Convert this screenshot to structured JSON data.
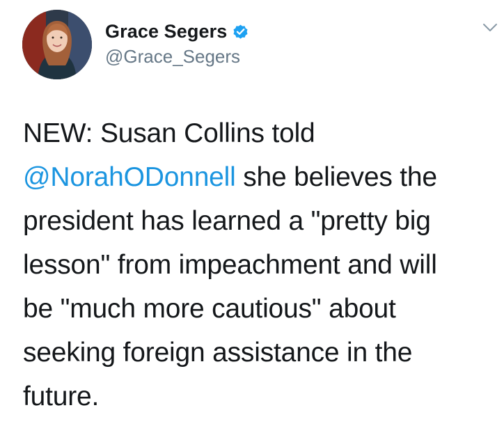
{
  "tweet": {
    "author": {
      "display_name": "Grace Segers",
      "handle": "@Grace_Segers",
      "verified": true,
      "verified_icon": "verified-badge-icon",
      "verified_color": "#1da1f2"
    },
    "menu_icon": "chevron-down-icon",
    "text": {
      "line1": "NEW: Susan Collins told",
      "mention": "@NorahODonnell",
      "line2_rest": " she believes the",
      "line3": "president has learned a \"pretty big",
      "line4": "lesson\" from impeachment and will",
      "line5": "be \"much more cautious\" about",
      "line6": "seeking foreign assistance in the",
      "line7": "future."
    },
    "colors": {
      "text": "#14171a",
      "secondary": "#657786",
      "link": "#1b95e0"
    }
  }
}
